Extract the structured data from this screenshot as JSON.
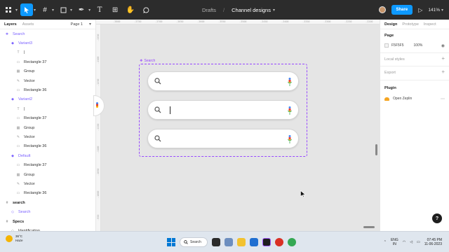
{
  "toolbar": {
    "breadcrumb_drafts": "Drafts",
    "breadcrumb_sep": "/",
    "file_name": "Channel designs",
    "share_label": "Share",
    "zoom": "141%",
    "accent": "#0d99ff"
  },
  "left_panel": {
    "tab_layers": "Layers",
    "tab_assets": "Assets",
    "page_label": "Page 1",
    "layers": [
      {
        "label": "Search",
        "icon": "component-icon",
        "purple": true
      },
      {
        "label": "Variant3",
        "icon": "variant-icon",
        "purple": true
      },
      {
        "label": "|",
        "icon": "text-icon"
      },
      {
        "label": "Rectangle 37",
        "icon": "rectangle-icon"
      },
      {
        "label": "Group",
        "icon": "group-icon"
      },
      {
        "label": "Vector",
        "icon": "vector-icon"
      },
      {
        "label": "Rectangle 36",
        "icon": "rectangle-icon"
      },
      {
        "label": "Variant2",
        "icon": "variant-icon",
        "purple": true
      },
      {
        "label": "|",
        "icon": "text-icon"
      },
      {
        "label": "Rectangle 37",
        "icon": "rectangle-icon"
      },
      {
        "label": "Group",
        "icon": "group-icon"
      },
      {
        "label": "Vector",
        "icon": "vector-icon"
      },
      {
        "label": "Rectangle 36",
        "icon": "rectangle-icon"
      },
      {
        "label": "Default",
        "icon": "variant-icon",
        "purple": true
      },
      {
        "label": "Rectangle 37",
        "icon": "rectangle-icon"
      },
      {
        "label": "Group",
        "icon": "group-icon"
      },
      {
        "label": "Vector",
        "icon": "vector-icon"
      },
      {
        "label": "Rectangle 36",
        "icon": "rectangle-icon"
      },
      {
        "label": "search",
        "icon": "frame-icon",
        "bold": true
      },
      {
        "label": "Search",
        "icon": "instance-icon",
        "purple": true
      },
      {
        "label": "Specs",
        "icon": "frame-icon",
        "bold": true
      },
      {
        "label": "Identification",
        "icon": "instance-icon"
      }
    ]
  },
  "canvas": {
    "frame_label": "Search",
    "frame_color": "#9747ff",
    "ruler_top": [
      "-3800",
      "-3750",
      "-3700",
      "-3650",
      "-3600",
      "-3550",
      "-3500",
      "-3450",
      "-3400",
      "-3350",
      "-3300",
      "-3250",
      "-3200"
    ],
    "ruler_left": [
      "-1350",
      "-1300",
      "-1250",
      "-1200",
      "-1150",
      "-1100",
      "-1050",
      "-1000",
      "-950"
    ]
  },
  "right_panel": {
    "tab_design": "Design",
    "tab_prototype": "Prototype",
    "tab_inspect": "Inspect",
    "page_title": "Page",
    "page_color": "F5F5F5",
    "page_opacity": "100%",
    "local_styles": "Local styles",
    "export": "Export",
    "plugin_title": "Plugin",
    "plugin_name": "Open Zeplin"
  },
  "help_label": "?",
  "taskbar": {
    "temperature": "36°C",
    "weather": "Haze",
    "search_label": "Search",
    "lang_top": "ENG",
    "lang_bottom": "IN",
    "time": "07:45 PM",
    "date": "11-06-2023"
  }
}
